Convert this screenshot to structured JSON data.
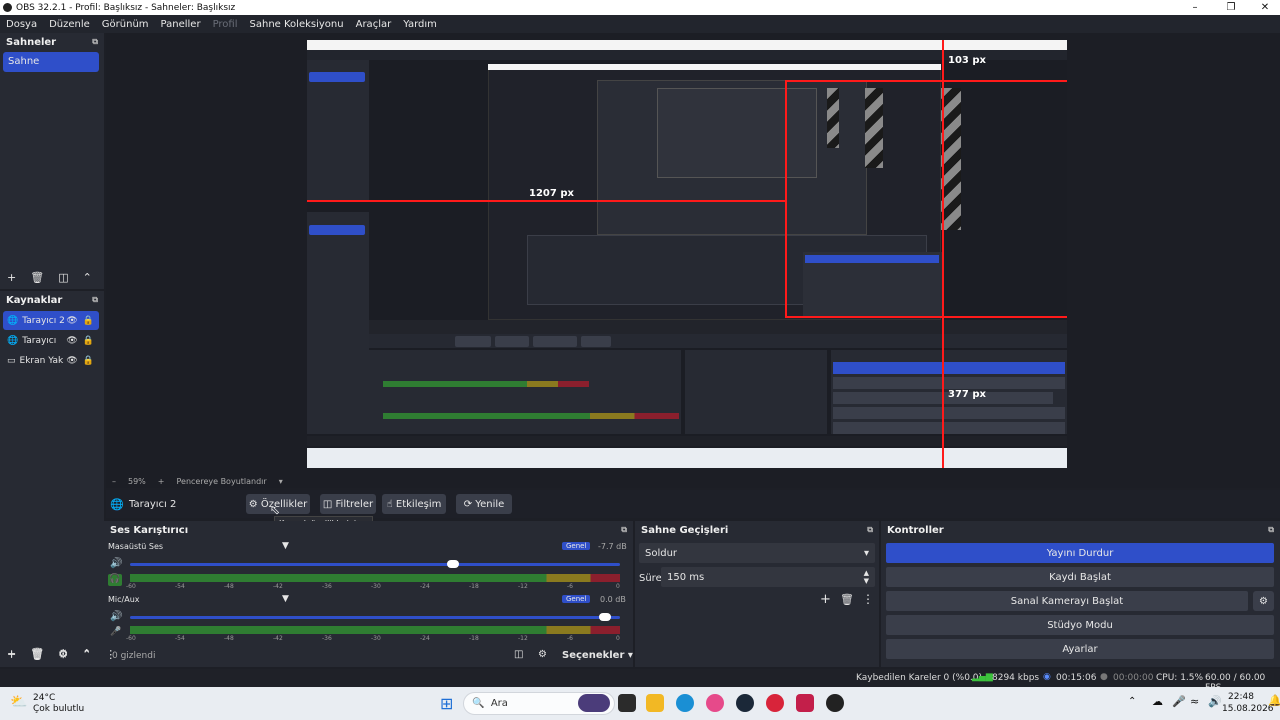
{
  "window": {
    "title": "OBS 32.2.1 - Profil: Başlıksız - Sahneler: Başlıksız"
  },
  "menu": [
    "Dosya",
    "Düzenle",
    "Görünüm",
    "Paneller",
    "Profil",
    "Sahne Koleksiyonu",
    "Araçlar",
    "Yardım"
  ],
  "scenes": {
    "title": "Sahneler",
    "items": [
      "Sahne"
    ]
  },
  "sources": {
    "title": "Kaynaklar",
    "items": [
      "Tarayıcı 2",
      "Tarayıcı",
      "Ekran Yak"
    ]
  },
  "preview": {
    "zoom": "59%",
    "fit_label": "Pencereye Boyutlandır",
    "measure_top": "103 px",
    "measure_left": "1207 px",
    "measure_bottom": "377 px"
  },
  "source_toolbar": {
    "source_name": "Tarayıcı 2",
    "properties": "Özellikler",
    "filters": "Filtreler",
    "interact": "Etkileşim",
    "refresh": "Yenile",
    "tooltip": "Kaynak özelliklerini aç"
  },
  "mixer": {
    "title": "Ses Karıştırıcı",
    "channels": [
      {
        "name": "Masaüstü Ses",
        "badge": "Genel",
        "db": "-7.7 dB",
        "level": 0.66
      },
      {
        "name": "Mic/Aux",
        "badge": "Genel",
        "db": "0.0 dB",
        "level": 0.97
      }
    ],
    "ticks": [
      "-60",
      "-54",
      "-48",
      "-42",
      "-36",
      "-30",
      "-24",
      "-18",
      "-12",
      "-6",
      "0"
    ],
    "hidden": "0 gizlendi",
    "section_label": "Seçenekler"
  },
  "transitions": {
    "title": "Sahne Geçişleri",
    "selected": "Soldur",
    "duration_label": "Süre",
    "duration": "150 ms"
  },
  "controls": {
    "title": "Kontroller",
    "buttons": [
      "Yayını Durdur",
      "Kaydı Başlat",
      "Sanal Kamerayı Başlat",
      "Stüdyo Modu",
      "Ayarlar"
    ]
  },
  "status": {
    "dropped": "Kaybedilen Kareler 0 (%0.0)",
    "bitrate": "8294 kbps",
    "stream_time": "00:15:06",
    "rec_time": "00:00:00",
    "cpu": "CPU: 1.5%",
    "fps": "60.00 / 60.00 FPS"
  },
  "taskbar": {
    "weather_temp": "24°C",
    "weather_desc": "Çok bulutlu",
    "search_placeholder": "Ara",
    "time": "22:48",
    "date": "15.08.2026"
  },
  "colors": {
    "accent": "#2f4fc9",
    "guide": "#ff1a1a",
    "meter_green": "#2f7d32",
    "meter_yellow": "#8a7a1f",
    "meter_red": "#8b1f2d"
  }
}
